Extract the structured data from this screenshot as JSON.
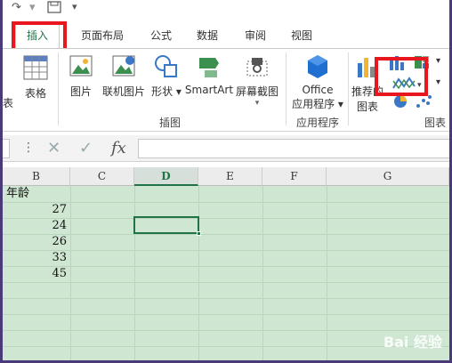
{
  "tabs": [
    {
      "label": "插入",
      "active": true
    },
    {
      "label": "页面布局"
    },
    {
      "label": "公式"
    },
    {
      "label": "数据"
    },
    {
      "label": "审阅"
    },
    {
      "label": "视图"
    }
  ],
  "ribbon": {
    "partial_left": "表",
    "table": "表格",
    "picture": "图片",
    "online_picture": "联机图片",
    "shapes": "形状",
    "smartart": "SmartArt",
    "screenshot": "屏幕截图",
    "office_line1": "Office",
    "office_line2": "应用程序",
    "recommend_line1": "推荐的",
    "recommend_line2": "图表",
    "group_illustrations": "插图",
    "group_apps": "应用程序",
    "group_charts": "图表"
  },
  "formula_bar": {
    "fx": "fx",
    "value": ""
  },
  "columns": [
    "B",
    "C",
    "D",
    "E",
    "F",
    "G"
  ],
  "selected_column": "D",
  "cells": {
    "header": "年龄",
    "values": [
      "27",
      "24",
      "26",
      "33",
      "45"
    ]
  },
  "colors": {
    "accent": "#217346",
    "highlight": "#e8171f",
    "sheet_bg": "#cfe7d2"
  },
  "watermark": "Bai 经验"
}
